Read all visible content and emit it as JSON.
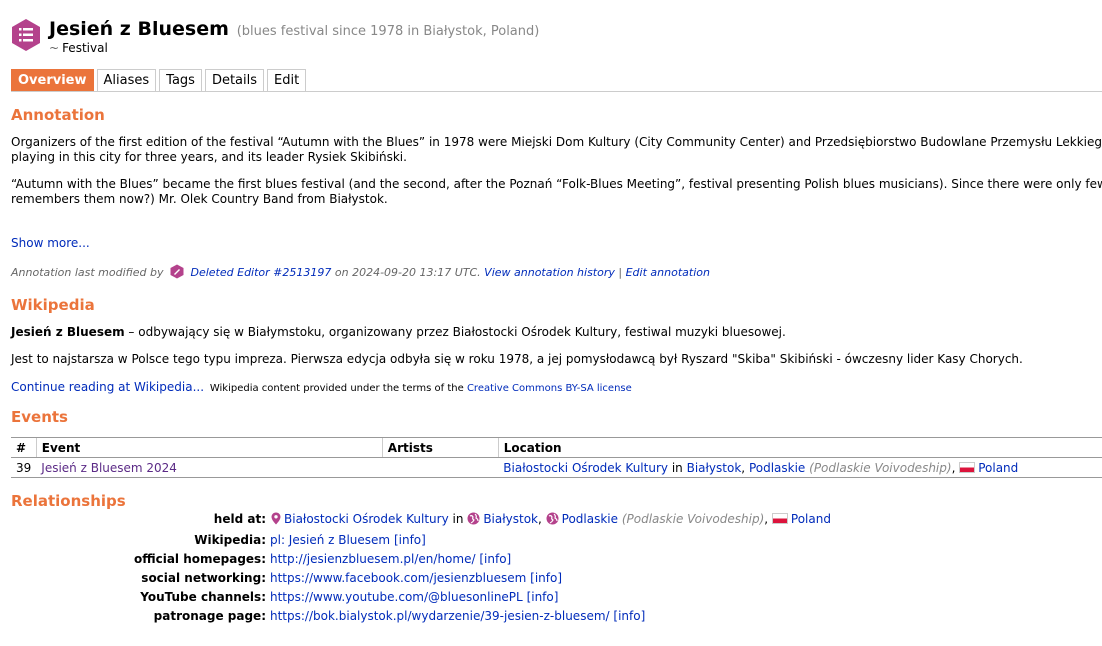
{
  "header": {
    "title": "Jesień z Bluesem",
    "comment": "(blues festival since 1978 in Białystok, Poland)",
    "tilde": "~",
    "type": "Festival",
    "icon": "event-series-icon",
    "icon_color": "#b4428c"
  },
  "tabs": [
    {
      "label": "Overview",
      "active": true
    },
    {
      "label": "Aliases"
    },
    {
      "label": "Tags"
    },
    {
      "label": "Details"
    },
    {
      "label": "Edit"
    }
  ],
  "annotation": {
    "heading": "Annotation",
    "p1a": "Organizers of the first edition of the festival “Autumn with the Blues” in 1978 were Miejski Dom Kultury (City Community Center) and Przedsiębiorstwo Budowlane Przemysłu Lekkiego",
    "p1b": "playing in this city for three years, and its leader Rysiek Skibiński.",
    "p2a": "“Autumn with the Blues” became the first blues festival (and the second, after the Poznań “Folk-Blues Meeting”, festival presenting Polish blues musicians). Since there were only few",
    "p2b": "remembers them now?) Mr. Olek Country Band from Białystok.",
    "show_more": "Show more...",
    "meta_prefix": "Annotation last modified by",
    "editor": "Deleted Editor #2513197",
    "meta_on": "on 2024-09-20 13:17 UTC.",
    "view_history": "View annotation history",
    "separator": "|",
    "edit_annotation": "Edit annotation"
  },
  "wikipedia": {
    "heading": "Wikipedia",
    "p1_bold": "Jesień z Bluesem",
    "p1_rest": " – odbywający się w Białymstoku, organizowany przez Białostocki Ośrodek Kultury, festiwal muzyki bluesowej.",
    "p2": "Jest to najstarsza w Polsce tego typu impreza. Pierwsza edycja odbyła się w roku 1978, a jej pomysłodawcą był Ryszard \"Skiba\" Skibiński - ówczesny lider Kasy Chorych.",
    "continue": "Continue reading at Wikipedia...",
    "license_prefix": "Wikipedia content provided under the terms of the",
    "license_link": "Creative Commons BY-SA license"
  },
  "events": {
    "heading": "Events",
    "columns": [
      "#",
      "Event",
      "Artists",
      "Location"
    ],
    "rows": [
      {
        "num": "39",
        "event": "Jesień z Bluesem 2024",
        "artists": "",
        "place": "Białostocki Ośrodek Kultury",
        "in": "in",
        "city": "Białystok",
        "comma": ",",
        "region": "Podlaskie",
        "region_comment": "(Podlaskie Voivodeship)",
        "country": "Poland"
      }
    ]
  },
  "relationships": {
    "heading": "Relationships",
    "held_at": {
      "label": "held at:",
      "place": "Białostocki Ośrodek Kultury",
      "in": "in",
      "city": "Białystok",
      "region": "Podlaskie",
      "region_comment": "(Podlaskie Voivodeship)",
      "country": "Poland"
    },
    "links": [
      {
        "label": "Wikipedia:",
        "url": "pl: Jesień z Bluesem",
        "info": "[info]"
      },
      {
        "label": "official homepages:",
        "url": "http://jesienzbluesem.pl/en/home/",
        "info": "[info]"
      },
      {
        "label": "social networking:",
        "url": "https://www.facebook.com/jesienzbluesem",
        "info": "[info]"
      },
      {
        "label": "YouTube channels:",
        "url": "https://www.youtube.com/@bluesonlinePL",
        "info": "[info]"
      },
      {
        "label": "patronage page:",
        "url": "https://bok.bialystok.pl/wydarzenie/39-jesien-z-bluesem/",
        "info": "[info]"
      }
    ]
  },
  "colors": {
    "accent": "#eb743b",
    "link": "#002bba",
    "event_link": "#5b2a86"
  }
}
